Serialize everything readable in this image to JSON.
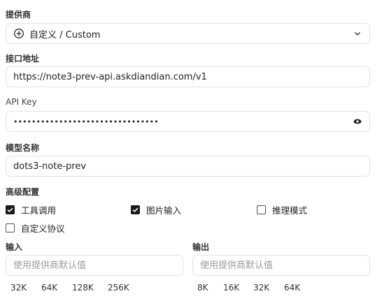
{
  "provider": {
    "label": "提供商",
    "selected": "自定义 / Custom",
    "icon": "plus-circle-icon"
  },
  "endpoint": {
    "label": "接口地址",
    "value": "https://note3-prev-api.askdiandian.com/v1"
  },
  "api_key": {
    "label": "API Key",
    "value": "••••••••••••••••••••••••••••••••"
  },
  "model": {
    "label": "模型名称",
    "value": "dots3-note-prev"
  },
  "advanced": {
    "label": "高级配置",
    "options": [
      {
        "label": "工具调用",
        "checked": true
      },
      {
        "label": "图片输入",
        "checked": true
      },
      {
        "label": "推理模式",
        "checked": false
      },
      {
        "label": "自定义协议",
        "checked": false
      }
    ]
  },
  "input": {
    "label": "输入",
    "placeholder": "使用提供商默认值",
    "presets": [
      "32K",
      "64K",
      "128K",
      "256K"
    ]
  },
  "output": {
    "label": "输出",
    "placeholder": "使用提供商默认值",
    "presets": [
      "8K",
      "16K",
      "32K",
      "64K"
    ]
  }
}
